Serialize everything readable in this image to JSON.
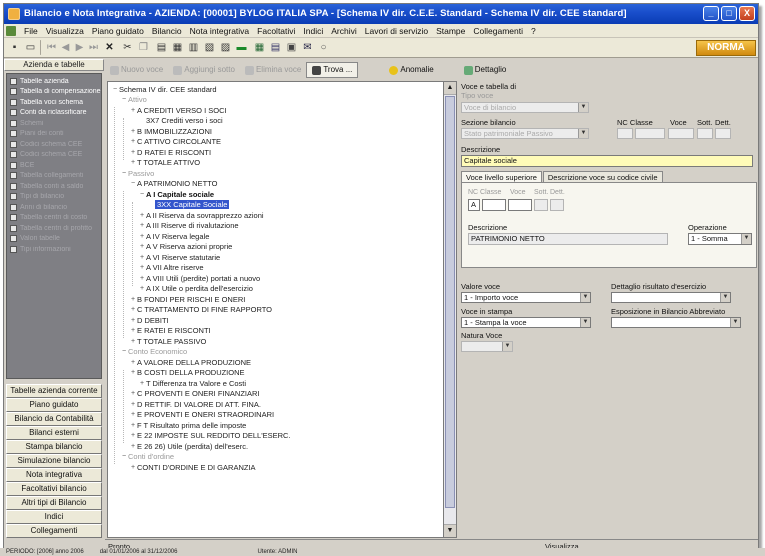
{
  "window": {
    "title": "Bilancio e Nota Integrativa - AZIENDA: [00001] BYLOG ITALIA SPA - [Schema IV dir. C.E.E. Standard - Schema IV dir. CEE standard]",
    "controls": [
      "_",
      "□",
      "X"
    ]
  },
  "menubar": [
    "File",
    "Visualizza",
    "Piano guidato",
    "Bilancio",
    "Nota integrativa",
    "Facoltativi",
    "Indici",
    "Archivi",
    "Lavori di servizio",
    "Stampe",
    "Collegamenti",
    "?"
  ],
  "toolbar": {
    "icons": [
      "save-icon",
      "print-icon",
      "first-icon",
      "prev-icon",
      "next-icon",
      "last-icon",
      "delete-icon",
      "cut-icon",
      "copy-icon",
      "paste-icon",
      "folder-icon",
      "chart-icon",
      "grid-icon",
      "mail-icon",
      "tree-icon"
    ],
    "brand": "NORMA"
  },
  "left_panel": {
    "header": "Azienda e tabelle",
    "nav_items": [
      {
        "label": "Tabelle azienda",
        "state": "active"
      },
      {
        "label": "Tabella di compensazione",
        "state": "active"
      },
      {
        "label": "Tabella voci schema",
        "state": "active"
      },
      {
        "label": "Conti da riclassificare",
        "state": "active"
      },
      {
        "label": "Schemi",
        "state": "dim"
      },
      {
        "label": "Piani dei conti",
        "state": "dim"
      },
      {
        "label": "Codici schema CEE",
        "state": "dim"
      },
      {
        "label": "Codici schema CEE",
        "state": "dim"
      },
      {
        "label": "BCE",
        "state": "dim"
      },
      {
        "label": "Tabella collegamenti",
        "state": "dim"
      },
      {
        "label": "Tabella conti a saldo",
        "state": "dim"
      },
      {
        "label": "Tipi di bilancio",
        "state": "dim"
      },
      {
        "label": "Anni di bilancio",
        "state": "dim"
      },
      {
        "label": "Tabella centri di costo",
        "state": "dim"
      },
      {
        "label": "Tabella centri di profitto",
        "state": "dim"
      },
      {
        "label": "Valori tabelle",
        "state": "dim"
      },
      {
        "label": "Tipi informazioni",
        "state": "dim"
      }
    ],
    "buttons": [
      {
        "label": "Tabelle azienda corrente",
        "selected": false
      },
      {
        "label": "Piano guidato",
        "selected": false
      },
      {
        "label": "Bilancio da Contabilità",
        "selected": false
      },
      {
        "label": "Bilanci esterni",
        "selected": false
      },
      {
        "label": "Stampa bilancio",
        "selected": false
      },
      {
        "label": "Simulazione bilancio",
        "selected": false
      },
      {
        "label": "Nota integrativa",
        "selected": false
      },
      {
        "label": "Facoltativi bilancio",
        "selected": false
      },
      {
        "label": "Altri tipi di Bilancio",
        "selected": false
      },
      {
        "label": "Indici",
        "selected": false
      },
      {
        "label": "Collegamenti",
        "selected": false
      }
    ]
  },
  "main_toolbar": {
    "buttons": [
      "Nuovo voce",
      "Aggiungi sotto",
      "Elimina voce",
      "Trova ...",
      "Anomalie",
      "Dettaglio"
    ]
  },
  "tree": [
    {
      "d": 0,
      "t": "Schema IV dir. CEE standard",
      "k": "root"
    },
    {
      "d": 1,
      "t": "Attivo",
      "k": "grp"
    },
    {
      "d": 2,
      "t": "A  CREDITI VERSO I SOCI",
      "k": "node"
    },
    {
      "d": 3,
      "t": "3X7  Crediti verso i soci",
      "k": "leaf"
    },
    {
      "d": 2,
      "t": "B  IMMOBILIZZAZIONI",
      "k": "node"
    },
    {
      "d": 2,
      "t": "C  ATTIVO CIRCOLANTE",
      "k": "node"
    },
    {
      "d": 2,
      "t": "D  RATEI E RISCONTI",
      "k": "node"
    },
    {
      "d": 2,
      "t": "T  TOTALE ATTIVO",
      "k": "node"
    },
    {
      "d": 1,
      "t": "Passivo",
      "k": "grp"
    },
    {
      "d": 2,
      "t": "A  PATRIMONIO NETTO",
      "k": "node"
    },
    {
      "d": 3,
      "t": "A  I  Capitale sociale",
      "k": "bold"
    },
    {
      "d": 4,
      "t": "3XX  Capitale Sociale",
      "k": "sel"
    },
    {
      "d": 3,
      "t": "A  II  Riserva da sovrapprezzo azioni",
      "k": "node"
    },
    {
      "d": 3,
      "t": "A  III  Riserve di rivalutazione",
      "k": "node"
    },
    {
      "d": 3,
      "t": "A  IV  Riserva legale",
      "k": "node"
    },
    {
      "d": 3,
      "t": "A  V  Riserva azioni proprie",
      "k": "node"
    },
    {
      "d": 3,
      "t": "A  VI  Riserve statutarie",
      "k": "node"
    },
    {
      "d": 3,
      "t": "A  VII  Altre riserve",
      "k": "node"
    },
    {
      "d": 3,
      "t": "A  VIII  Utili (perdite) portati a nuovo",
      "k": "node"
    },
    {
      "d": 3,
      "t": "A  IX  Utile o perdita dell'esercizio",
      "k": "node"
    },
    {
      "d": 2,
      "t": "B  FONDI PER RISCHI E ONERI",
      "k": "node"
    },
    {
      "d": 2,
      "t": "C  TRATTAMENTO DI FINE RAPPORTO",
      "k": "node"
    },
    {
      "d": 2,
      "t": "D  DEBITI",
      "k": "node"
    },
    {
      "d": 2,
      "t": "E  RATEI E RISCONTI",
      "k": "node"
    },
    {
      "d": 2,
      "t": "T  TOTALE PASSIVO",
      "k": "node"
    },
    {
      "d": 1,
      "t": "Conto Economico",
      "k": "grp"
    },
    {
      "d": 2,
      "t": "A  VALORE DELLA PRODUZIONE",
      "k": "node"
    },
    {
      "d": 2,
      "t": "B  COSTI DELLA PRODUZIONE",
      "k": "node"
    },
    {
      "d": 3,
      "t": "T  Differenza tra Valore e Costi",
      "k": "node"
    },
    {
      "d": 2,
      "t": "C  PROVENTI E ONERI FINANZIARI",
      "k": "node"
    },
    {
      "d": 2,
      "t": "D  RETTIF. DI VALORE DI ATT. FINA.",
      "k": "node"
    },
    {
      "d": 2,
      "t": "E  PROVENTI E ONERI STRAORDINARI",
      "k": "node"
    },
    {
      "d": 2,
      "t": "F  T  Risultato prima delle imposte",
      "k": "node"
    },
    {
      "d": 2,
      "t": "E  22  IMPOSTE SUL REDDITO DELL'ESERC.",
      "k": "node"
    },
    {
      "d": 2,
      "t": "E  26  26) Utile (perdita) dell'eserc.",
      "k": "node"
    },
    {
      "d": 1,
      "t": "Conti d'ordine",
      "k": "grp"
    },
    {
      "d": 2,
      "t": "CONTI D'ORDINE E DI GARANZIA",
      "k": "node"
    }
  ],
  "form": {
    "section_title": "Voce e tabella di",
    "tipo_voce_label": "Tipo voce",
    "tipo_voce_value": "Voce di bilancio",
    "sezione_label": "Sezione bilancio",
    "sezione_value": "Stato patrimoniale Passivo",
    "nc_classe_label": "NC Classe",
    "voce_label": "Voce",
    "sott_label": "Sott.",
    "dett_label": "Dett.",
    "descrizione_label": "Descrizione",
    "descrizione_value": "Capitale sociale",
    "tab_1": "Voce livello superiore",
    "tab_2": "Descrizione voce su codice civile",
    "grid_nc_classe": "NC Classe",
    "grid_voce": "Voce",
    "grid_sott": "Sott.",
    "grid_dett": "Dett.",
    "grid_value": "A",
    "sub_desc_label": "Descrizione",
    "sub_desc_value": "PATRIMONIO NETTO",
    "operazione_label": "Operazione",
    "operazione_value": "1 - Somma",
    "valore_voce_label": "Valore voce",
    "valore_voce_value": "1 - Importo voce",
    "voce_stampa_label": "Voce in stampa",
    "voce_stampa_value": "1 - Stampa la voce",
    "natura_label": "Natura Voce",
    "dettaglio_label": "Dettaglio risultato d'esercizio",
    "esposizione_label": "Esposizione in Bilancio Abbreviato"
  },
  "status": {
    "left": "Pronto",
    "right": "Visualizza"
  },
  "bottombar": {
    "left": "PERIODO: [2006] anno 2006",
    "middle": "dal 01/01/2006 al 31/12/2006",
    "right": "Utente: ADMIN"
  },
  "colors": {
    "titlebar": "#1a4fcc",
    "nav_bg": "#7f7f84",
    "selection": "#3355cc",
    "brand": "#e8a020",
    "description_field": "#fffbb8"
  }
}
